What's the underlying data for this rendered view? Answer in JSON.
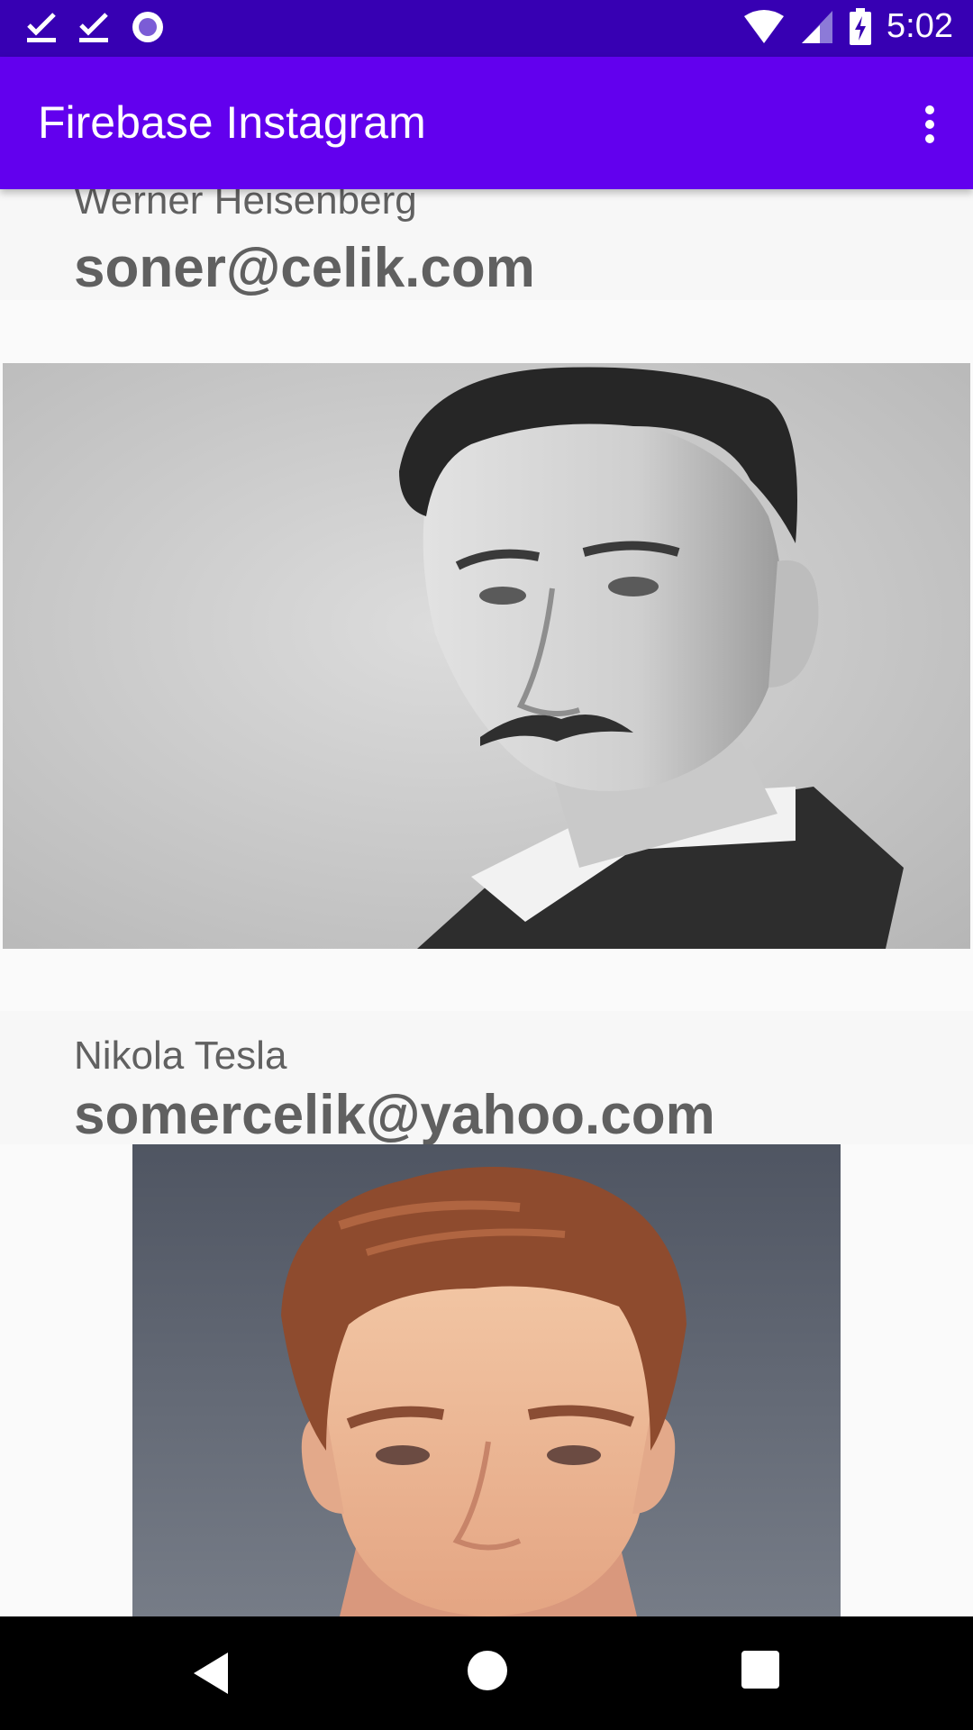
{
  "status_bar": {
    "time": "5:02",
    "icons": [
      "check-notification-icon",
      "check-notification-icon",
      "circle-notification-icon",
      "wifi-icon",
      "signal-icon",
      "battery-charging-icon"
    ]
  },
  "app_bar": {
    "title": "Firebase Instagram",
    "overflow_icon": "more-vert-icon"
  },
  "posts": [
    {
      "name": "Werner Heisenberg",
      "email": "soner@celik.com",
      "photo": "portrait-photo-black-and-white"
    },
    {
      "name": "Nikola Tesla",
      "email": "somercelik@yahoo.com",
      "photo": "portrait-photo-color"
    }
  ],
  "nav_bar": {
    "icons": [
      "back-icon",
      "home-icon",
      "recents-icon"
    ]
  },
  "colors": {
    "status_bar": "#3700b3",
    "app_bar": "#6200ee",
    "text_gray": "#606060",
    "nav_bar": "#000000"
  }
}
